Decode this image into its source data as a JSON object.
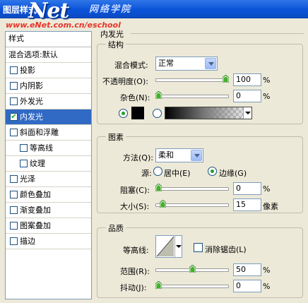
{
  "window": {
    "title": "图层样式",
    "watermark_logo": "Net",
    "watermark_cn": "网络学院",
    "watermark_url": "www.eNet.com.cn/eschool"
  },
  "style_list": {
    "header": "样式",
    "items": [
      {
        "label": "混合选项:默认",
        "checkbox": false,
        "checked": false,
        "selected": false,
        "sub": false
      },
      {
        "label": "投影",
        "checkbox": true,
        "checked": false,
        "selected": false,
        "sub": false
      },
      {
        "label": "内阴影",
        "checkbox": true,
        "checked": false,
        "selected": false,
        "sub": false
      },
      {
        "label": "外发光",
        "checkbox": true,
        "checked": false,
        "selected": false,
        "sub": false
      },
      {
        "label": "内发光",
        "checkbox": true,
        "checked": true,
        "selected": true,
        "sub": false
      },
      {
        "label": "斜面和浮雕",
        "checkbox": true,
        "checked": false,
        "selected": false,
        "sub": false
      },
      {
        "label": "等高线",
        "checkbox": true,
        "checked": false,
        "selected": false,
        "sub": true
      },
      {
        "label": "纹理",
        "checkbox": true,
        "checked": false,
        "selected": false,
        "sub": true
      },
      {
        "label": "光泽",
        "checkbox": true,
        "checked": false,
        "selected": false,
        "sub": false
      },
      {
        "label": "颜色叠加",
        "checkbox": true,
        "checked": false,
        "selected": false,
        "sub": false
      },
      {
        "label": "渐变叠加",
        "checkbox": true,
        "checked": false,
        "selected": false,
        "sub": false
      },
      {
        "label": "图案叠加",
        "checkbox": true,
        "checked": false,
        "selected": false,
        "sub": false
      },
      {
        "label": "描边",
        "checkbox": true,
        "checked": false,
        "selected": false,
        "sub": false
      }
    ]
  },
  "panel": {
    "title": "内发光",
    "structure": {
      "title": "结构",
      "blend_mode_label": "混合模式:",
      "blend_mode_value": "正常",
      "opacity_label": "不透明度(O):",
      "opacity_value": "100",
      "opacity_unit": "%",
      "opacity_level": 1.0,
      "noise_label": "杂色(N):",
      "noise_value": "0",
      "noise_unit": "%",
      "noise_level": 0.0,
      "color_swatch": "#000000",
      "gradient_from": "#000000"
    },
    "elements": {
      "title": "图素",
      "method_label": "方法(Q):",
      "method_value": "柔和",
      "source_label": "源:",
      "source_center": "居中(E)",
      "source_edge": "边缘(G)",
      "choke_label": "阻塞(C):",
      "choke_value": "0",
      "choke_unit": "%",
      "choke_level": 0.0,
      "size_label": "大小(S):",
      "size_value": "15",
      "size_unit": "像素",
      "size_level": 0.06
    },
    "quality": {
      "title": "品质",
      "contour_label": "等高线:",
      "antialias_label": "消除锯齿(L)",
      "range_label": "范围(R):",
      "range_value": "50",
      "range_unit": "%",
      "range_level": 0.5,
      "jitter_label": "抖动(J):",
      "jitter_value": "0",
      "jitter_unit": "%",
      "jitter_level": 0.0
    }
  }
}
